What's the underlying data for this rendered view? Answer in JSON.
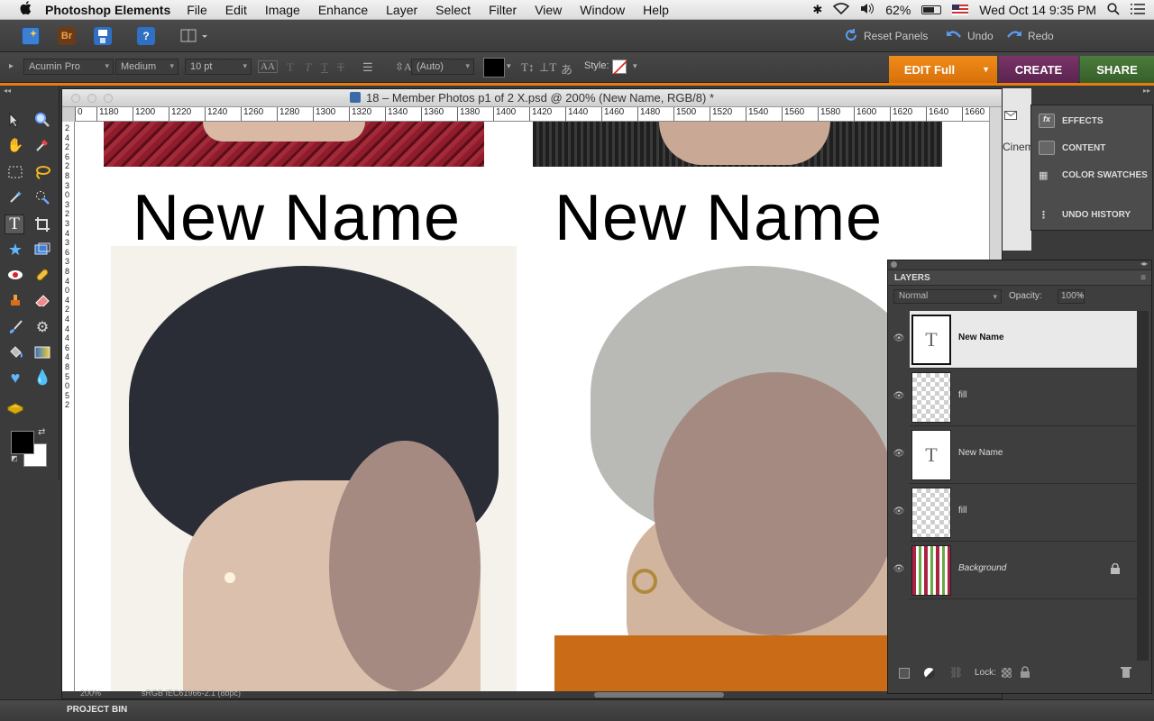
{
  "menubar": {
    "app_name": "Photoshop Elements",
    "menus": [
      "File",
      "Edit",
      "Image",
      "Enhance",
      "Layer",
      "Select",
      "Filter",
      "View",
      "Window",
      "Help"
    ],
    "battery": "62%",
    "clock": "Wed Oct 14  9:35 PM"
  },
  "toolbar": {
    "reset_panels": "Reset Panels",
    "undo": "Undo",
    "redo": "Redo",
    "bridge_badge": "Br"
  },
  "options": {
    "font_family": "Acumin Pro",
    "font_style": "Medium",
    "font_size": "10 pt",
    "leading": "(Auto)",
    "style_label": "Style:",
    "text_color": "#000000"
  },
  "modes": {
    "edit": "EDIT Full",
    "create": "CREATE",
    "share": "SHARE"
  },
  "document": {
    "title": "18 – Member Photos p1 of 2 X.psd @ 200% (New Name, RGB/8) *",
    "ruler_ticks": [
      "0",
      "1180",
      "1200",
      "1220",
      "1240",
      "1260",
      "1280",
      "1300",
      "1320",
      "1340",
      "1360",
      "1380",
      "1400",
      "1420",
      "1440",
      "1460",
      "1480",
      "1500",
      "1520",
      "1540",
      "1560",
      "1580",
      "1600",
      "1620",
      "1640",
      "1660"
    ],
    "vruler_digits": [
      "2",
      "4",
      "2",
      "6",
      "2",
      "8",
      "3",
      "0",
      "3",
      "2",
      "3",
      "4",
      "3",
      "6",
      "3",
      "8",
      "4",
      "0",
      "4",
      "2",
      "4",
      "4",
      "4",
      "6",
      "4",
      "8",
      "5",
      "0",
      "5",
      "2"
    ],
    "names": [
      "New Name",
      "New Name"
    ],
    "status_zoom": "200%",
    "status_profile": "sRGB IEC61966-2.1 (8bpc)"
  },
  "panel_menu": {
    "items": [
      "EFFECTS",
      "CONTENT",
      "COLOR SWATCHES",
      "UNDO HISTORY"
    ],
    "side_label": "Cinem"
  },
  "layers_panel": {
    "title": "LAYERS",
    "blend_mode": "Normal",
    "opacity_label": "Opacity:",
    "opacity_value": "100%",
    "lock_label": "Lock:",
    "layers": [
      {
        "name": "New Name",
        "kind": "text",
        "selected": true
      },
      {
        "name": "fill",
        "kind": "transparent",
        "selected": false
      },
      {
        "name": "New Name",
        "kind": "text",
        "selected": false
      },
      {
        "name": "fill",
        "kind": "transparent",
        "selected": false
      },
      {
        "name": "Background",
        "kind": "image",
        "selected": false,
        "locked": true
      }
    ]
  },
  "project_bin": {
    "label": "PROJECT BIN"
  },
  "colors": {
    "accent_orange": "#e87d0f",
    "create_purple": "#6a2b5a",
    "share_green": "#3f6e32",
    "face_mask": "#a58a82",
    "sweater_red": "#8e1c2c"
  }
}
